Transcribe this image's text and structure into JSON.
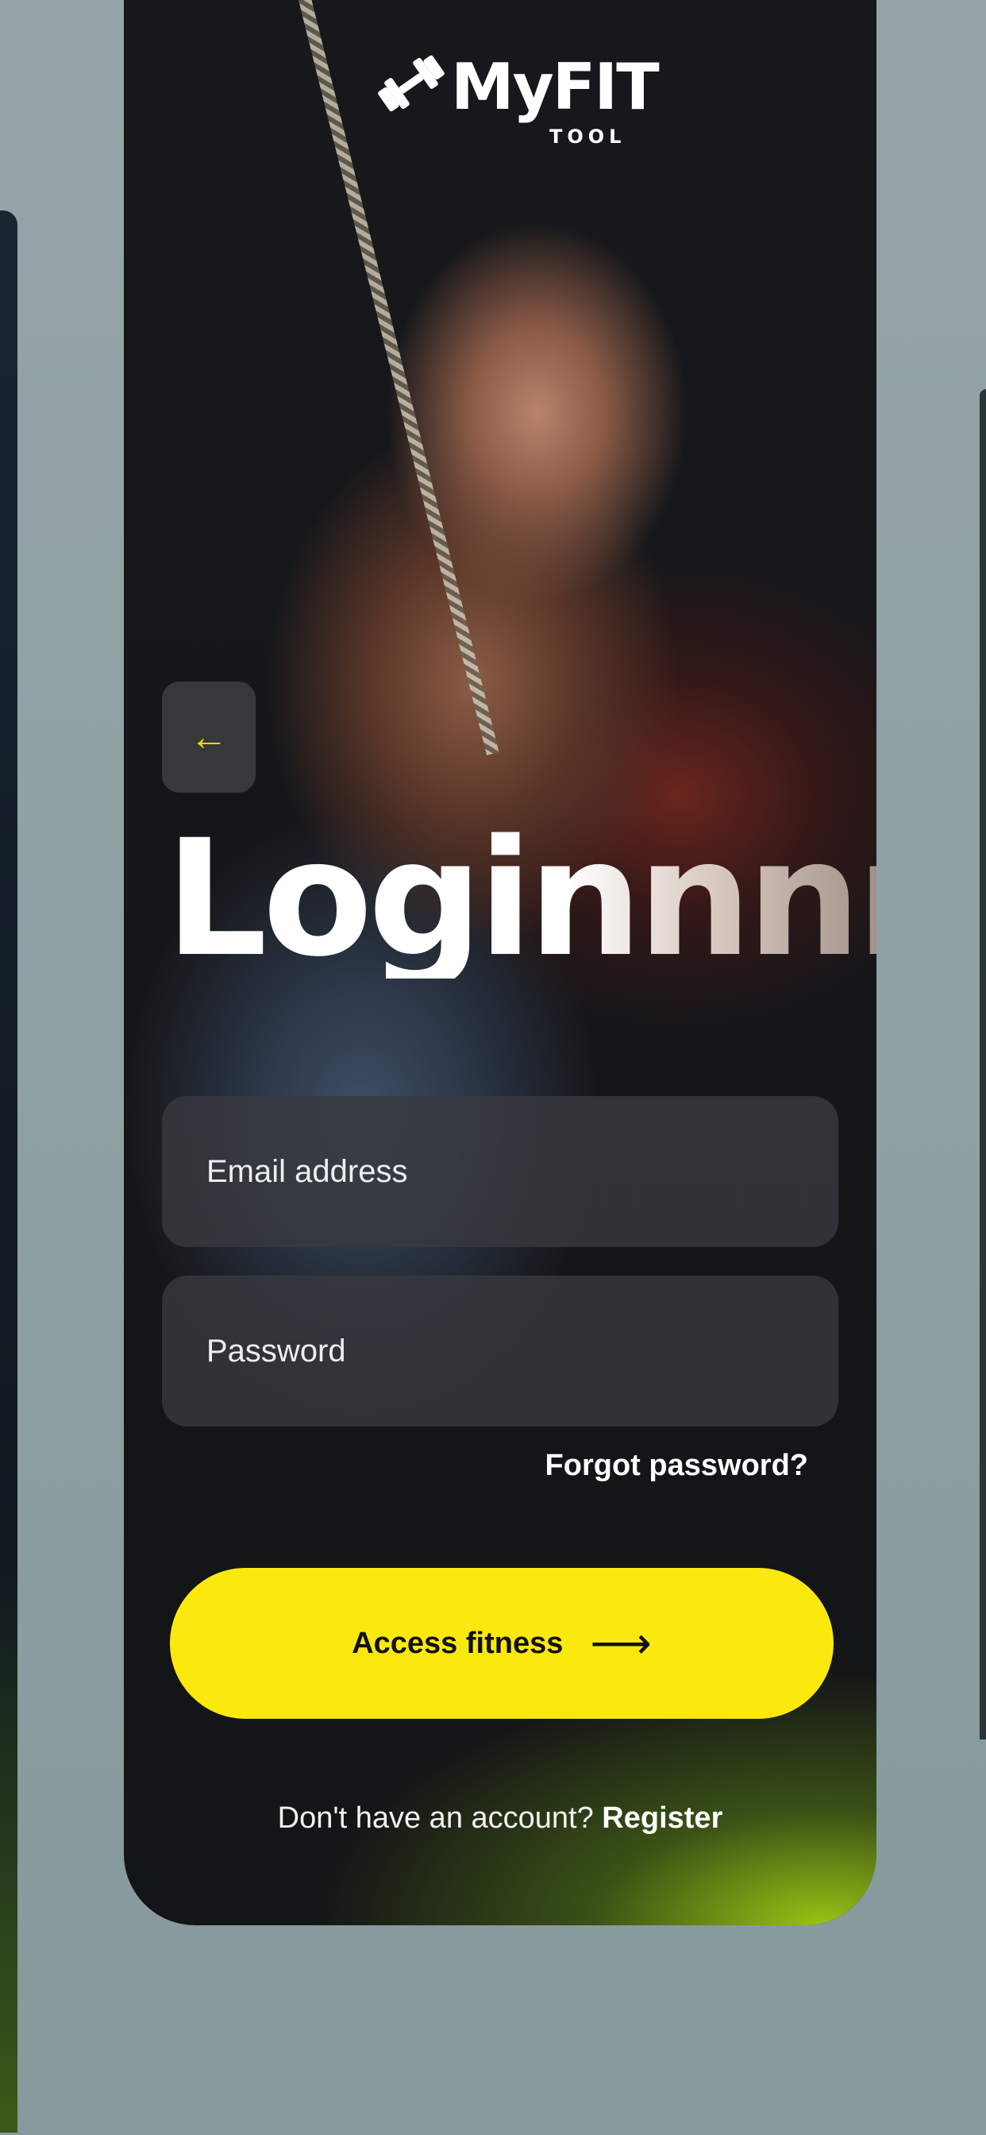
{
  "app": {
    "logo_main": "MyFIT",
    "logo_sub": "TOOL"
  },
  "screen": {
    "title": "Loginnnn"
  },
  "back_button": {
    "icon": "arrow-left-icon",
    "glyph": "←"
  },
  "form": {
    "email_placeholder": "Email address",
    "password_placeholder": "Password",
    "forgot_label": "Forgot password?"
  },
  "cta": {
    "label": "Access fitness",
    "arrow": "⟶"
  },
  "register": {
    "prompt": "Don't have an account? ",
    "link": "Register"
  },
  "colors": {
    "accent": "#fbe90d",
    "card_bg": "#141517",
    "field_bg": "#37393e",
    "page_bg": "#8ea0a3"
  }
}
